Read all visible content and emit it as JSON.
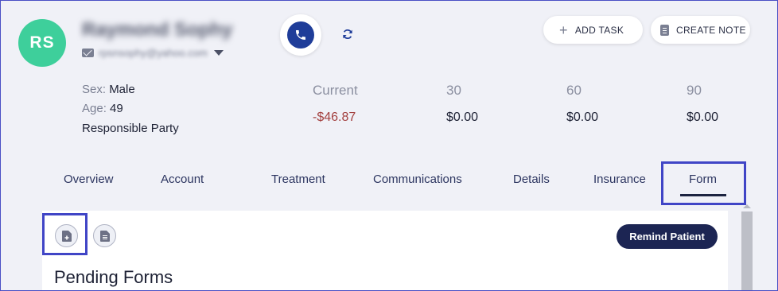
{
  "patient": {
    "initials": "RS",
    "name": "Raymond Sophy",
    "email": "rpsnsophy@yahoo.com",
    "sex_label": "Sex:",
    "sex": "Male",
    "age_label": "Age:",
    "age": "49",
    "responsible_party": "Responsible Party"
  },
  "actions": {
    "add_task": "ADD TASK",
    "create_note": "CREATE NOTE"
  },
  "aging": {
    "columns": [
      {
        "label": "Current",
        "value": "-$46.87"
      },
      {
        "label": "30",
        "value": "$0.00"
      },
      {
        "label": "60",
        "value": "$0.00"
      },
      {
        "label": "90",
        "value": "$0.00"
      }
    ]
  },
  "tabs": [
    {
      "label": "Overview"
    },
    {
      "label": "Account"
    },
    {
      "label": "Treatment"
    },
    {
      "label": "Communications"
    },
    {
      "label": "Details"
    },
    {
      "label": "Insurance"
    },
    {
      "label": "Form",
      "active": true
    }
  ],
  "panel": {
    "remind_button": "Remind Patient",
    "title": "Pending Forms"
  },
  "colors": {
    "avatar": "#3ecf9b",
    "call_button": "#1f3d99",
    "negative_balance": "#a3403f",
    "primary_button": "#1c2553",
    "highlight": "#4045c6"
  }
}
